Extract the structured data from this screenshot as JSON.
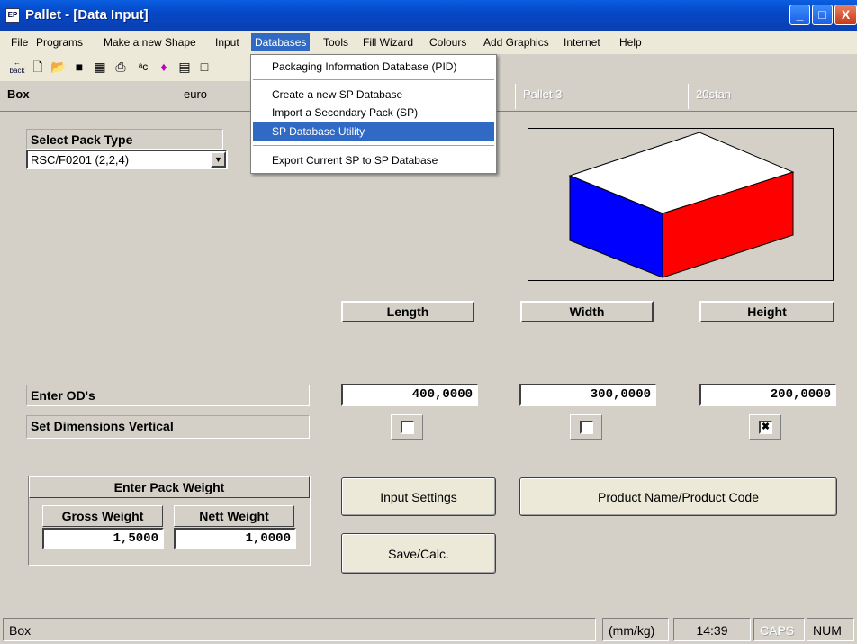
{
  "window": {
    "title": "Pallet - [Data Input]",
    "icon": "app-icon",
    "icon_text": "EP",
    "minimize": "_",
    "maximize": "□",
    "close": "X"
  },
  "menu": [
    "File",
    "Programs",
    "Make a new Shape",
    "Input",
    "Databases",
    "Tools",
    "Fill Wizard",
    "Colours",
    "Add Graphics",
    "Internet",
    "Help"
  ],
  "databases_menu": {
    "items": [
      "Packaging Information Database (PID)",
      "Create a new SP Database",
      "Import a Secondary Pack (SP)",
      "SP Database Utility",
      "Export Current SP to SP Database"
    ],
    "highlighted": "SP Database Utility"
  },
  "toolbar": {
    "back_label": "back",
    "icons": [
      "back-icon",
      "new-file-icon",
      "open-folder-icon",
      "save-icon",
      "calculator-icon",
      "print-icon",
      "spell-icon",
      "shapes-icon",
      "notes-icon",
      "copy-icon"
    ]
  },
  "tabs": [
    "Box",
    "euro",
    "Pallet 3",
    "20stan"
  ],
  "pack_type": {
    "label": "Select Pack Type",
    "value": "RSC/F0201 (2,2,4)"
  },
  "dimensions": {
    "headers": [
      "Length",
      "Width",
      "Height"
    ],
    "ods_label": "Enter OD's",
    "vertical_label": "Set Dimensions Vertical",
    "values": [
      "400,0000",
      "300,0000",
      "200,0000"
    ],
    "vertical_checked": [
      false,
      false,
      true
    ],
    "check_mark": "✖"
  },
  "weight": {
    "title": "Enter Pack Weight",
    "gross_label": "Gross Weight",
    "nett_label": "Nett Weight",
    "gross": "1,5000",
    "nett": "1,0000"
  },
  "buttons": {
    "input_settings": "Input Settings",
    "product_name": "Product Name/Product Code",
    "save_calc": "Save/Calc."
  },
  "box_colors": {
    "top": "#ffffff",
    "left": "#0000ff",
    "right": "#ff0000"
  },
  "status": {
    "text": "Box",
    "units": "(mm/kg)",
    "time": "14:39",
    "caps": "CAPS",
    "num": "NUM"
  }
}
